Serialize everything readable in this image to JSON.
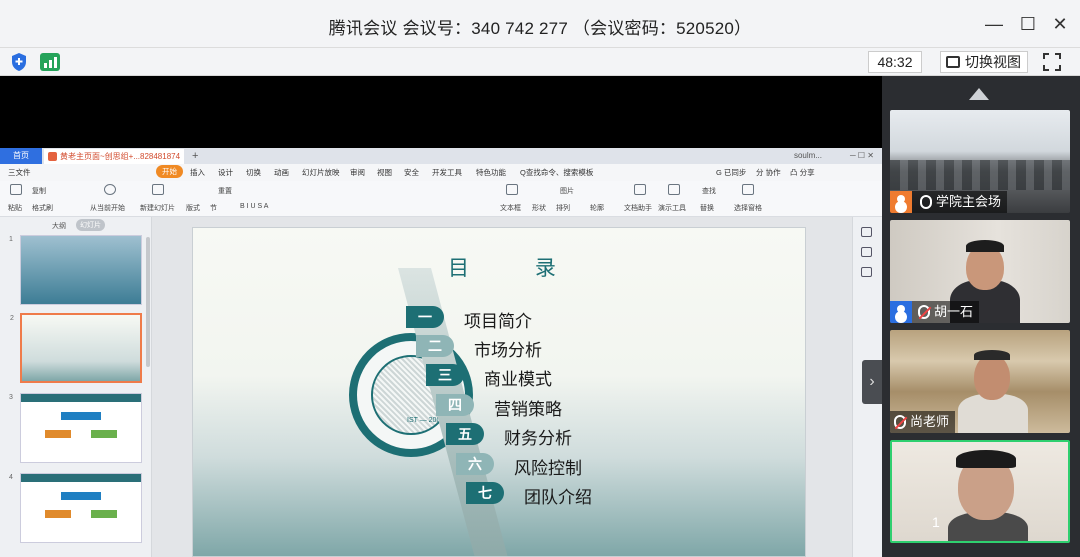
{
  "window": {
    "title": "腾讯会议 会议号：340 742 277  （会议密码：520520）",
    "controls": {
      "minimize": "—",
      "maximize": "☐",
      "close": "✕"
    }
  },
  "toolbar": {
    "timer": "48:32",
    "switch_view_label": "切换视图",
    "colors": {
      "shield": "#2a6ee0",
      "signal": "#25a35a"
    }
  },
  "wps": {
    "home_tab": "首页",
    "doc_tab": "黄老主页面~创思组+...828481874",
    "window_right": "soulm...",
    "menu": [
      "三文件",
      "开始",
      "插入",
      "设计",
      "切换",
      "动画",
      "幻灯片放映",
      "审阅",
      "视图",
      "安全",
      "开发工具",
      "特色功能",
      "Q查找命令、搜索模板",
      "G 已同步",
      "分 协作",
      "凸 分享"
    ],
    "ribbon": [
      "粘贴",
      "复制",
      "格式刷",
      "从当前开始",
      "新建幻灯片",
      "版式",
      "节",
      "重置",
      "文本框",
      "形状",
      "排列",
      "图片",
      "轮廓",
      "文档助手",
      "演示工具",
      "替换",
      "选择窗格",
      "查找"
    ],
    "thumbs_header": [
      "大纲",
      "幻灯片"
    ],
    "thumb_numbers": [
      "1",
      "2",
      "3",
      "4"
    ]
  },
  "slide": {
    "title": "目 录",
    "seal_text": "IST — 2001",
    "items": [
      {
        "num": "一",
        "text": "项目简介"
      },
      {
        "num": "二",
        "text": "市场分析"
      },
      {
        "num": "三",
        "text": "商业模式"
      },
      {
        "num": "四",
        "text": "营销策略"
      },
      {
        "num": "五",
        "text": "财务分析"
      },
      {
        "num": "六",
        "text": "风险控制"
      },
      {
        "num": "七",
        "text": "团队介绍"
      }
    ]
  },
  "participants": [
    {
      "name": "学院主会场",
      "role": "host"
    },
    {
      "name": "胡一石",
      "role": "member"
    },
    {
      "name": "尚老师",
      "role": "member"
    },
    {
      "name": "1",
      "role": "speaking"
    }
  ]
}
